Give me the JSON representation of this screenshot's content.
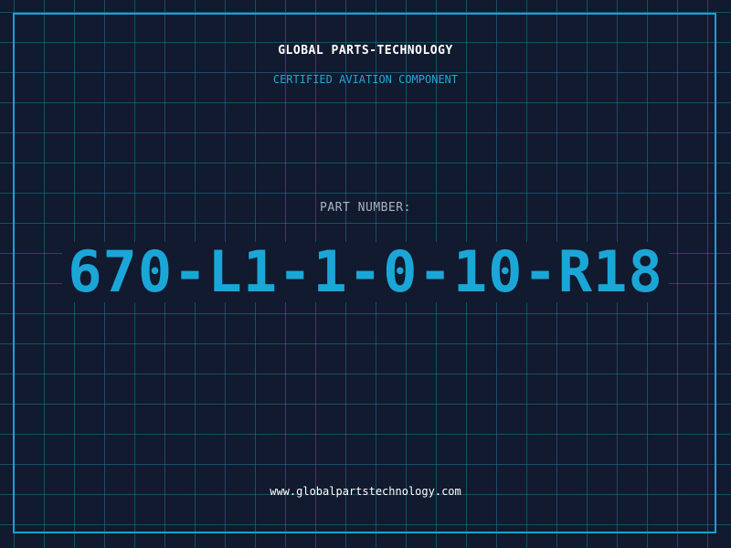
{
  "header": {
    "company_name": "GLOBAL PARTS-TECHNOLOGY",
    "tagline": "CERTIFIED AVIATION COMPONENT"
  },
  "part": {
    "label": "PART NUMBER:",
    "number": "670-L1-1-0-10-R18"
  },
  "footer": {
    "website": "www.globalpartstechnology.com"
  },
  "colors": {
    "background": "#111a2e",
    "grid": "#2078963",
    "accent": "#1aa7d8",
    "frame": "#16a3d0",
    "title_text": "#ffffff",
    "label_text": "#a9b4c3"
  }
}
